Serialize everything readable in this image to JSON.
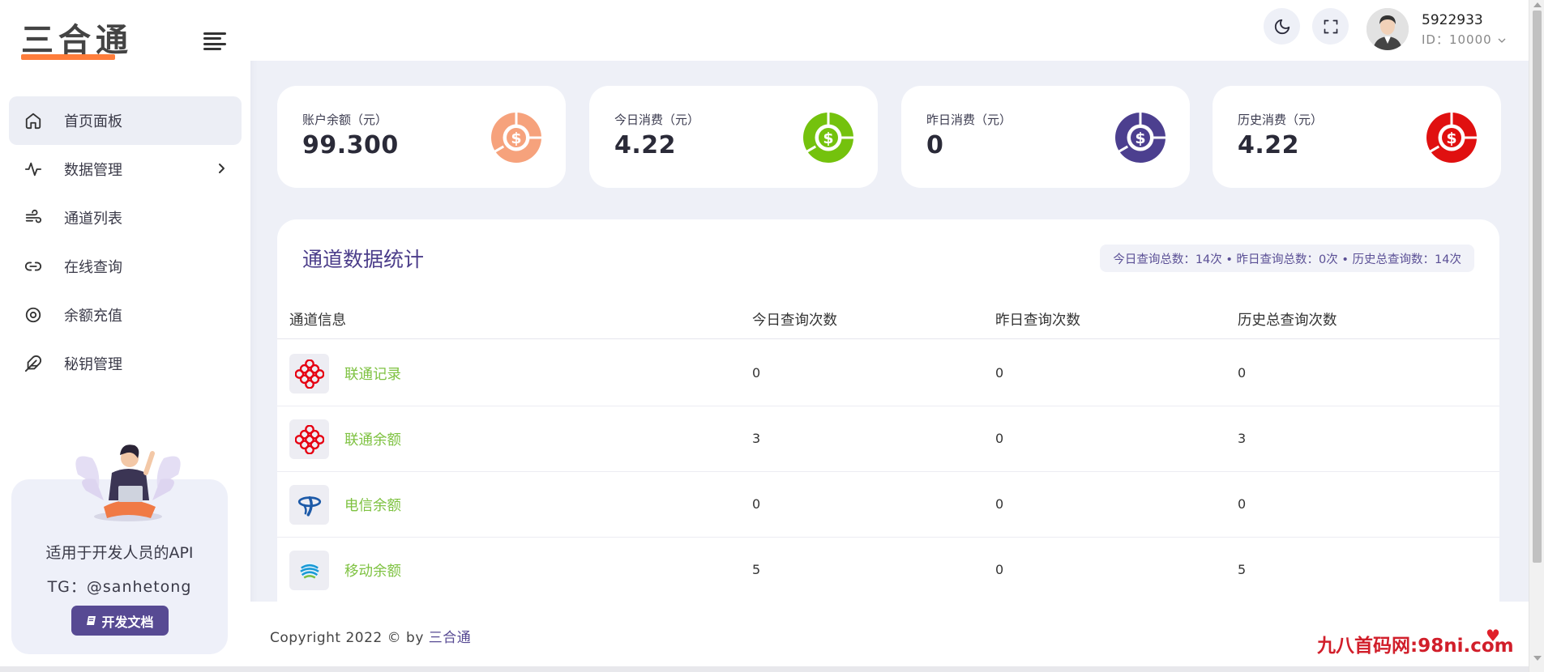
{
  "app": {
    "logo_text": "三合通"
  },
  "sidebar": {
    "items": [
      {
        "label": "首页面板",
        "icon": "home-icon",
        "active": true
      },
      {
        "label": "数据管理",
        "icon": "activity-icon",
        "has_submenu": true
      },
      {
        "label": "通道列表",
        "icon": "wind-icon"
      },
      {
        "label": "在线查询",
        "icon": "link-icon"
      },
      {
        "label": "余额充值",
        "icon": "target-icon"
      },
      {
        "label": "秘钥管理",
        "icon": "feather-icon"
      }
    ],
    "promo": {
      "title": "适用于开发人员的API",
      "tg": "TG：@sanhetong",
      "button_label": "开发文档"
    }
  },
  "header": {
    "user": {
      "name": "5922933",
      "id_text": "ID：10000"
    }
  },
  "stats": [
    {
      "label": "账户余额（元）",
      "value": "99.300",
      "color": "#f6a27c"
    },
    {
      "label": "今日消费（元）",
      "value": "4.22",
      "color": "#74c20d"
    },
    {
      "label": "昨日消费（元）",
      "value": "0",
      "color": "#4c3f8f"
    },
    {
      "label": "历史消费（元）",
      "value": "4.22",
      "color": "#e01010"
    }
  ],
  "channels": {
    "title": "通道数据统计",
    "summary": "今日查询总数：14次 • 昨日查询总数：0次 • 历史总查询数：14次",
    "columns": [
      "通道信息",
      "今日查询次数",
      "昨日查询次数",
      "历史总查询次数"
    ],
    "rows": [
      {
        "name": "联通记录",
        "icon": "china-unicom-icon",
        "today": "0",
        "yesterday": "0",
        "total": "0"
      },
      {
        "name": "联通余额",
        "icon": "china-unicom-icon",
        "today": "3",
        "yesterday": "0",
        "total": "3"
      },
      {
        "name": "电信余额",
        "icon": "china-telecom-icon",
        "today": "0",
        "yesterday": "0",
        "total": "0"
      },
      {
        "name": "移动余额",
        "icon": "china-mobile-icon",
        "today": "5",
        "yesterday": "0",
        "total": "5"
      }
    ]
  },
  "footer": {
    "copyright_prefix": "Copyright 2022 © by ",
    "brand": "三合通",
    "watermark": "九八首码网:98ni.com"
  }
}
